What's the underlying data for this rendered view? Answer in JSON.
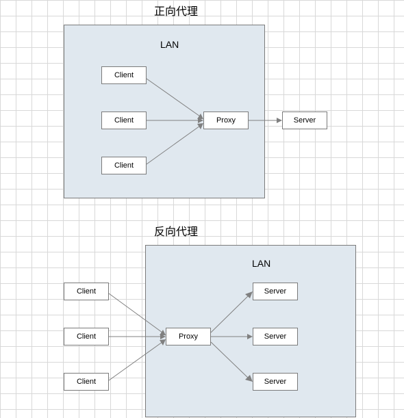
{
  "forward": {
    "title": "正向代理",
    "lan_label": "LAN",
    "clients": [
      "Client",
      "Client",
      "Client"
    ],
    "proxy": "Proxy",
    "server": "Server"
  },
  "reverse": {
    "title": "反向代理",
    "lan_label": "LAN",
    "clients": [
      "Client",
      "Client",
      "Client"
    ],
    "proxy": "Proxy",
    "servers": [
      "Server",
      "Server",
      "Server"
    ]
  }
}
